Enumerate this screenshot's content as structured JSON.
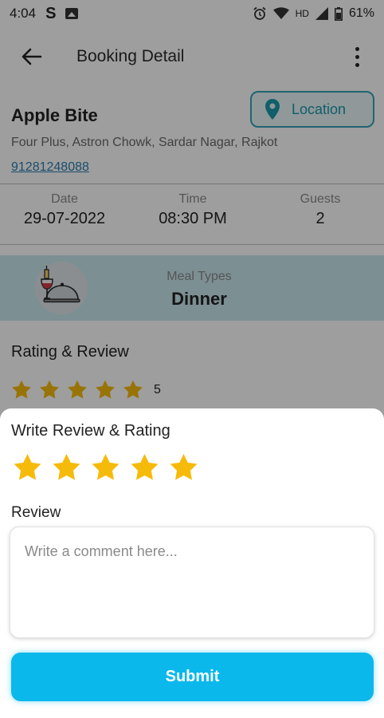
{
  "status_bar": {
    "time": "4:04",
    "app_letter": "S",
    "network": "HD",
    "battery": "61%"
  },
  "app_bar": {
    "title": "Booking Detail",
    "back_icon": "arrow-left-icon",
    "menu_icon": "more-vertical-icon"
  },
  "restaurant": {
    "name": "Apple Bite",
    "address": "Four Plus, Astron Chowk, Sardar Nagar, Rajkot",
    "phone": "91281248088",
    "location_button": "Location"
  },
  "booking_info": [
    {
      "label": "Date",
      "value": "29-07-2022"
    },
    {
      "label": "Time",
      "value": "08:30 PM"
    },
    {
      "label": "Guests",
      "value": "2"
    }
  ],
  "meal": {
    "label": "Meal Types",
    "value": "Dinner",
    "icon": "dinner-icon"
  },
  "rating_section": {
    "title": "Rating & Review",
    "stars": 5,
    "score": "5"
  },
  "review_sheet": {
    "title": "Write Review & Rating",
    "stars_selected": 5,
    "stars_total": 5,
    "review_label": "Review",
    "review_placeholder": "Write a comment here...",
    "review_value": "",
    "submit_label": "Submit"
  },
  "colors": {
    "accent": "#0ab8ec",
    "star": "#f6bb0a",
    "location": "#1a9aad",
    "meal_band": "#c9e7ee"
  }
}
